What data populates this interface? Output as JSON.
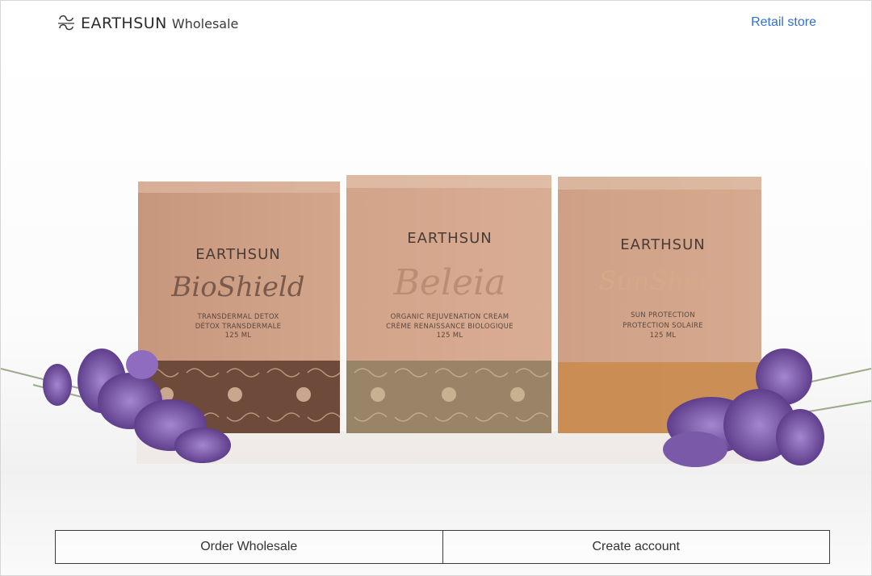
{
  "header": {
    "brand": "EARTHSUN",
    "brand_sub": "Wholesale",
    "retail_link": "Retail store"
  },
  "hero": {
    "products": [
      {
        "brand": "EARTHSUN",
        "name": "BioShield",
        "line1": "TRANSDERMAL DETOX",
        "line2": "DÉTOX TRANSDERMALE",
        "size": "125 ML"
      },
      {
        "brand": "EARTHSUN",
        "name": "Beleia",
        "line1": "ORGANIC REJUVENATION CREAM",
        "line2": "CRÈME RENAISSANCE BIOLOGIQUE",
        "size": "125 ML"
      },
      {
        "brand": "EARTHSUN",
        "name": "SunSheer",
        "line1": "SUN PROTECTION",
        "line2": "PROTECTION SOLAIRE",
        "size": "125 ML"
      }
    ]
  },
  "actions": {
    "order_label": "Order Wholesale",
    "create_label": "Create account"
  },
  "colors": {
    "link": "#2f6fd6",
    "kraft": "#c99a80",
    "band_brown": "#6e4a3a",
    "band_olive": "#9a8468",
    "band_amber": "#c98a4a",
    "lavender": "#7a5aa8"
  }
}
